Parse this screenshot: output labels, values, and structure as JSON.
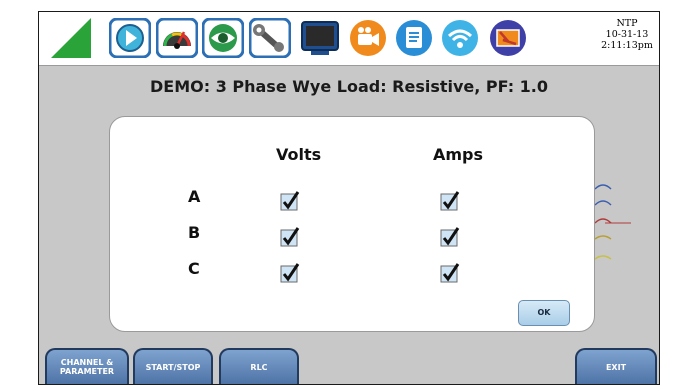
{
  "status": {
    "sync": "NTP",
    "date": "10-31-13",
    "time": "2:11:13pm"
  },
  "toolbar": {
    "icons": [
      "logo-triangle",
      "play-icon",
      "gauge-icon",
      "eye-icon",
      "wrench-icon",
      "monitor-icon",
      "camera-icon",
      "document-icon",
      "wifi-icon",
      "alert-icon"
    ]
  },
  "title": "DEMO: 3 Phase Wye Load: Resistive, PF: 1.0",
  "dialog": {
    "columns": [
      "Volts",
      "Amps"
    ],
    "rows": [
      {
        "label": "A",
        "volts": true,
        "amps": true
      },
      {
        "label": "B",
        "volts": true,
        "amps": true
      },
      {
        "label": "C",
        "volts": true,
        "amps": true
      }
    ],
    "ok_label": "OK"
  },
  "softkeys": {
    "channel_line1": "CHANNEL &",
    "channel_line2": "PARAMETER",
    "start_stop": "START/STOP",
    "rlc": "RLC",
    "exit": "EXIT"
  },
  "colors": {
    "logo": "#2aa339",
    "icon_blue": "#2c6fb5",
    "icon_orange": "#f08a1c",
    "icon_red": "#c0392b",
    "checkbox_fill": "#cfe4f5",
    "softkey": "#5b7fb3"
  }
}
